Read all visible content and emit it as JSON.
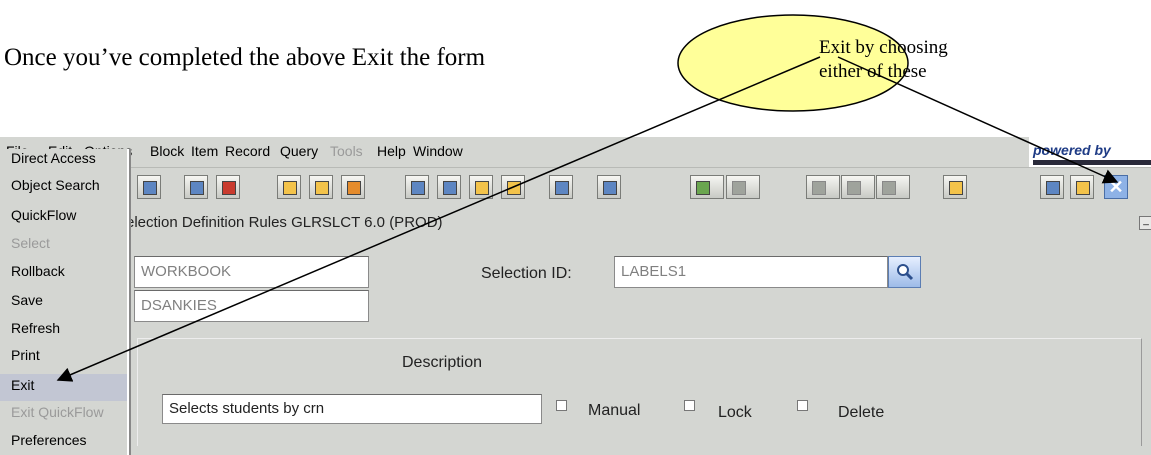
{
  "instruction": "Once you’ve completed the above Exit the form",
  "callout": {
    "line1": "Exit by choosing",
    "line2": "either of these"
  },
  "menubar": {
    "items": [
      {
        "label": "File"
      },
      {
        "label": "Edit"
      },
      {
        "label": "Options"
      },
      {
        "label": "Block"
      },
      {
        "label": "Item"
      },
      {
        "label": "Record"
      },
      {
        "label": "Query"
      },
      {
        "label": "Tools"
      },
      {
        "label": "Help"
      },
      {
        "label": "Window"
      }
    ],
    "powered_by": "powered by"
  },
  "file_menu": {
    "items": [
      {
        "label": "Direct Access",
        "enabled": true
      },
      {
        "label": "Object Search",
        "enabled": true
      },
      {
        "label": "QuickFlow",
        "enabled": true
      },
      {
        "label": "Select",
        "enabled": false
      },
      {
        "label": "Rollback",
        "enabled": true
      },
      {
        "label": "Save",
        "enabled": true
      },
      {
        "label": "Refresh",
        "enabled": true
      },
      {
        "label": "Print",
        "enabled": true
      },
      {
        "label": "Exit",
        "enabled": true,
        "highlighted": true
      },
      {
        "label": "Exit QuickFlow",
        "enabled": false
      },
      {
        "label": "Preferences",
        "enabled": true
      }
    ]
  },
  "form": {
    "title": "election Definition Rules  GLRSLCT  6.0  (PROD)",
    "application_value": "WORKBOOK",
    "creator_value": "DSANKIES",
    "selection_id_label": "Selection ID:",
    "selection_id_value": "LABELS1",
    "description_label": "Description",
    "description_value": "Selects students by crn",
    "manual_label": "Manual",
    "lock_label": "Lock",
    "delete_label": "Delete"
  },
  "colors": {
    "chrome": "#d4d6d2",
    "callout_fill": "#ffff99",
    "exit_button": "#8eb2e6",
    "menu_highlight": "#c2c6d3"
  }
}
